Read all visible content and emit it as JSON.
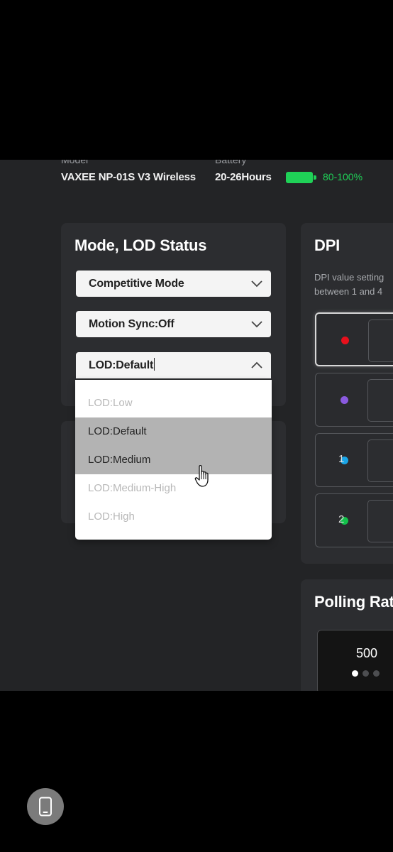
{
  "header": {
    "model_label": "Model",
    "model_value": "VAXEE NP-01S V3 Wireless",
    "battery_label": "Battery",
    "battery_life": "20-26Hours",
    "battery_percent": "80-100%",
    "battery_level": 1.0
  },
  "mode_card": {
    "title": "Mode, LOD Status",
    "mode_select": "Competitive Mode",
    "motion_sync_select": "Motion Sync:Off",
    "lod_select": "LOD:Default",
    "lod_options": [
      "LOD:Low",
      "LOD:Default",
      "LOD:Medium",
      "LOD:Medium-High",
      "LOD:High"
    ]
  },
  "dpi_card": {
    "title": "DPI",
    "desc_line1": "DPI value setting",
    "desc_line2": "between 1 and 4",
    "stages": [
      {
        "color": "#e8101c"
      },
      {
        "color": "#8a5ae0"
      },
      {
        "color": "#1aa6e8"
      },
      {
        "color": "#13c24b"
      }
    ],
    "partial_values": [
      "1",
      "2"
    ]
  },
  "polling_card": {
    "title": "Polling Rat",
    "value": "500"
  },
  "colors": {
    "background": "#232426",
    "card": "#2c2d30",
    "accent_green": "#1fd157"
  }
}
